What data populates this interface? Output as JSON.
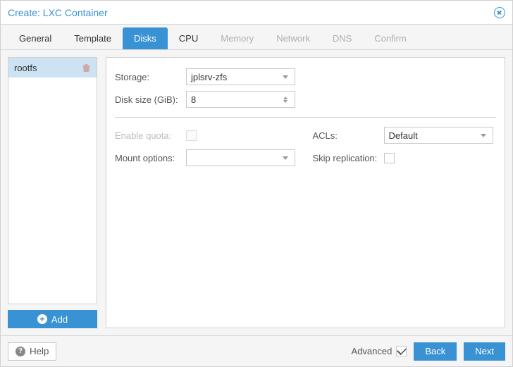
{
  "window": {
    "title": "Create: LXC Container"
  },
  "tabs": [
    {
      "label": "General",
      "state": "enabled"
    },
    {
      "label": "Template",
      "state": "enabled"
    },
    {
      "label": "Disks",
      "state": "active"
    },
    {
      "label": "CPU",
      "state": "enabled"
    },
    {
      "label": "Memory",
      "state": "disabled"
    },
    {
      "label": "Network",
      "state": "disabled"
    },
    {
      "label": "DNS",
      "state": "disabled"
    },
    {
      "label": "Confirm",
      "state": "disabled"
    }
  ],
  "sidebar": {
    "items": [
      {
        "name": "rootfs"
      }
    ],
    "add_label": "Add"
  },
  "form": {
    "storage": {
      "label": "Storage:",
      "value": "jplsrv-zfs"
    },
    "disk_size": {
      "label": "Disk size (GiB):",
      "value": "8"
    },
    "enable_quota": {
      "label": "Enable quota:",
      "checked": false,
      "disabled": true
    },
    "acls": {
      "label": "ACLs:",
      "value": "Default"
    },
    "mount_options": {
      "label": "Mount options:",
      "value": ""
    },
    "skip_replication": {
      "label": "Skip replication:",
      "checked": false
    }
  },
  "footer": {
    "help_label": "Help",
    "advanced_label": "Advanced",
    "advanced_checked": true,
    "back_label": "Back",
    "next_label": "Next"
  }
}
